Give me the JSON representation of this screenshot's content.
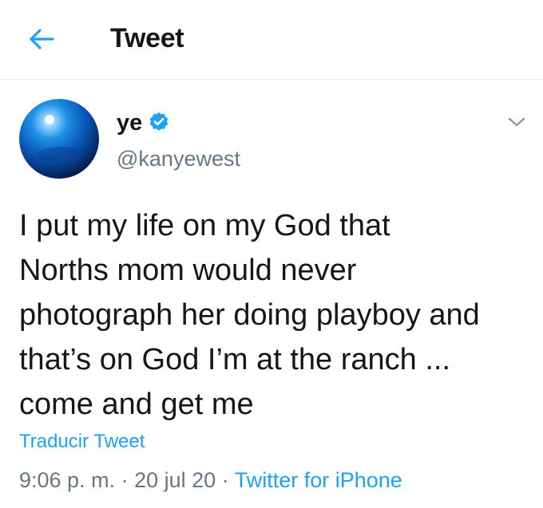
{
  "header": {
    "title": "Tweet",
    "back_icon": "arrow-left-icon"
  },
  "colors": {
    "accent": "#1da1f2",
    "text": "#14171a",
    "secondary": "#657786",
    "divider": "#e6ecf0"
  },
  "tweet": {
    "author": {
      "name": "ye",
      "handle": "@kanyewest",
      "verified": true
    },
    "text": "I put my life on my God that\nNorths mom would never\nphotograph her doing playboy and\nthat’s on God    I’m at the ranch ...\ncome and get me",
    "translate_label": "Traducir Tweet",
    "time": "9:06 p. m.",
    "separator": "·",
    "date": "20 jul 20",
    "source": "Twitter for iPhone"
  }
}
